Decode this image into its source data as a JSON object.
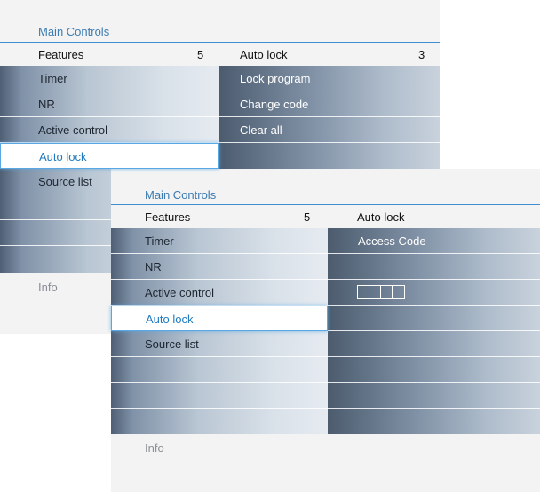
{
  "back_panel": {
    "title": "Main Controls",
    "header": {
      "left_label": "Features",
      "left_count": "5",
      "right_label": "Auto lock",
      "right_count": "3"
    },
    "left_items": [
      "Timer",
      "NR",
      "Active control",
      "Auto lock",
      "Source list",
      "",
      "",
      ""
    ],
    "selected_left": "Auto lock",
    "right_items": [
      "Lock program",
      "Change code",
      "Clear all",
      ""
    ],
    "info": "Info"
  },
  "front_panel": {
    "title": "Main Controls",
    "header": {
      "left_label": "Features",
      "left_count": "5",
      "right_label": "Auto lock"
    },
    "left_items": [
      "Timer",
      "NR",
      "Active control",
      "Auto lock",
      "Source list",
      "",
      "",
      ""
    ],
    "selected_left": "Auto lock",
    "right_items": [
      "Access Code",
      "",
      "",
      "",
      "",
      "",
      "",
      ""
    ],
    "code_digits": 4,
    "info": "Info"
  },
  "colors": {
    "accent": "#3f8fd0",
    "selected_text": "#1f7ac0",
    "title": "#3c7bb0"
  }
}
